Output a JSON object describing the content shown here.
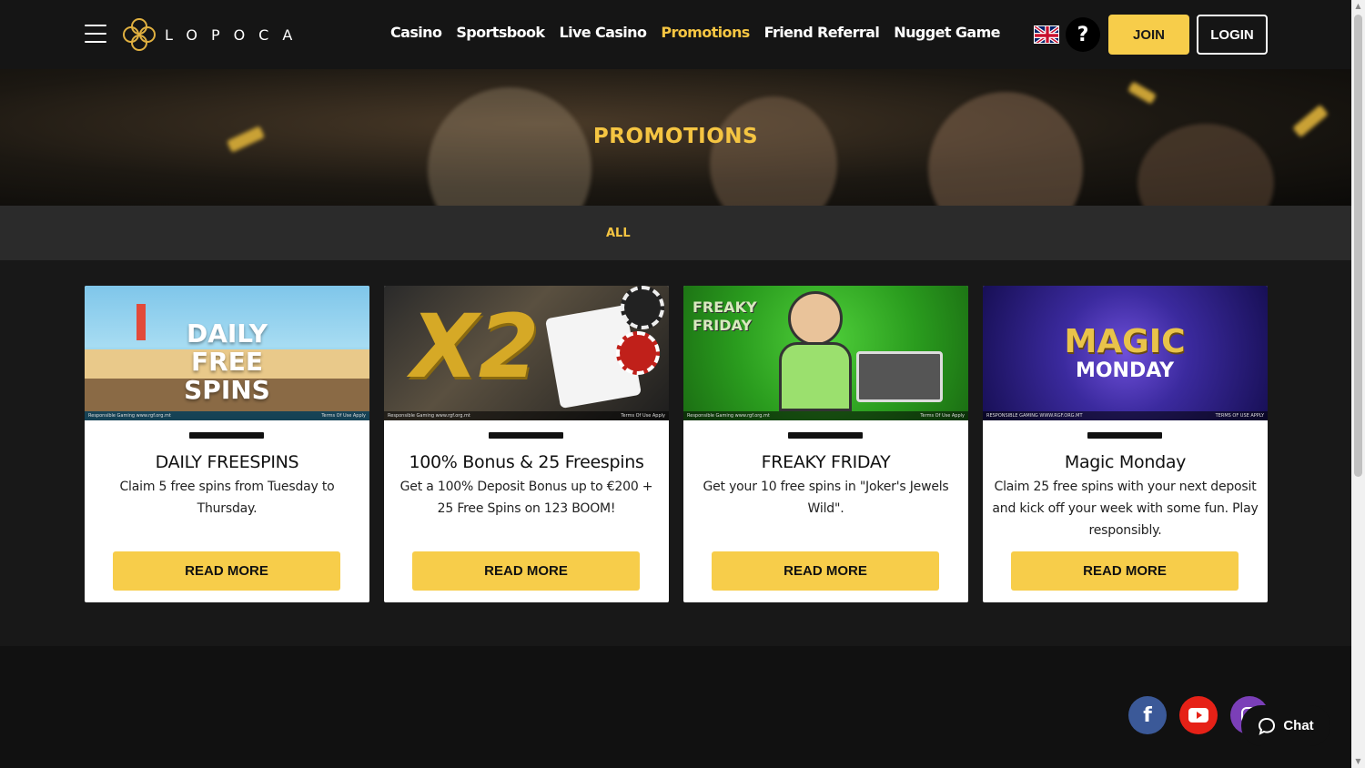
{
  "header": {
    "logo_text": "LOPOCA",
    "nav": [
      "Casino",
      "Sportsbook",
      "Live Casino",
      "Promotions",
      "Friend Referral",
      "Nugget Game"
    ],
    "active_nav": "Promotions",
    "help_label": "?",
    "join_label": "JOIN",
    "login_label": "LOGIN"
  },
  "hero": {
    "title": "PROMOTIONS"
  },
  "filter": {
    "all_label": "ALL"
  },
  "promos": [
    {
      "image_line1": "DAILY",
      "image_line2": "FREE SPINS",
      "image_footer_left": "Responsible Gaming www.rgf.org.mt",
      "image_footer_right": "Terms Of Use Apply",
      "title": "DAILY FREESPINS",
      "description": "Claim 5 free spins from Tuesday to Thursday.",
      "button": "READ MORE"
    },
    {
      "image_line1": "X2",
      "image_footer_left": "Responsible Gaming www.rgf.org.mt",
      "image_footer_right": "Terms Of Use Apply",
      "title": "100% Bonus & 25 Freespins",
      "description": "Get a 100% Deposit Bonus up to €200 + 25 Free Spins on 123 BOOM!",
      "button": "READ MORE"
    },
    {
      "image_line1": "FREAKY",
      "image_line2": "FRIDAY",
      "image_footer_left": "Responsible Gaming www.rgf.org.mt",
      "image_footer_right": "Terms Of Use Apply",
      "title": "FREAKY FRIDAY",
      "description": "Get your 10 free spins in \"Joker's Jewels Wild\".",
      "button": "READ MORE"
    },
    {
      "image_line1": "MAGIC",
      "image_line2": "MONDAY",
      "image_footer_left": "RESPONSIBLE GAMING WWW.RGF.ORG.MT",
      "image_footer_right": "TERMS OF USE APPLY",
      "title": "Magic Monday",
      "description": "Claim 25 free spins with your next deposit and kick off your week with some fun. Play responsibly.",
      "button": "READ MORE"
    }
  ],
  "footer": {
    "social": [
      "facebook-icon",
      "youtube-icon",
      "instagram-icon"
    ],
    "chat_label": "Chat"
  },
  "colors": {
    "accent": "#f5c542",
    "button": "#f7cd4a",
    "header_bg": "#151515"
  }
}
